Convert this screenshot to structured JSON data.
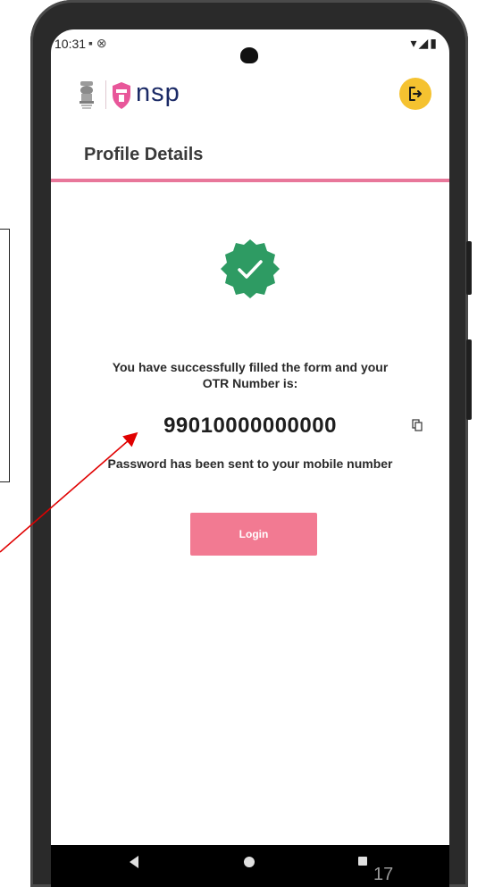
{
  "status_bar": {
    "time": "10:31",
    "left_icons": "▪ ⊗",
    "right_icons": "▾◢▮"
  },
  "header": {
    "logo_text": "nsp",
    "emblem_icon": "national-emblem-icon",
    "logout_icon": "logout-icon",
    "logout_color": "#f5c230",
    "brand_color": "#e8579a"
  },
  "page": {
    "title": "Profile Details",
    "accent_rule_color": "#e8779a"
  },
  "success": {
    "badge_icon": "check-badge-icon",
    "badge_color": "#2e9b63",
    "line1": "You have successfully filled the form and your",
    "line2": "OTR Number is:",
    "otr_number": "99010000000000",
    "copy_icon": "copy-icon",
    "password_message": "Password has been sent to your mobile number"
  },
  "actions": {
    "login_label": "Login",
    "login_color": "#f27a92"
  },
  "nav_bar": {
    "back_icon": "back-triangle-icon",
    "home_icon": "home-circle-icon",
    "recent_icon": "recents-square-icon"
  },
  "slide": {
    "number": "17"
  }
}
